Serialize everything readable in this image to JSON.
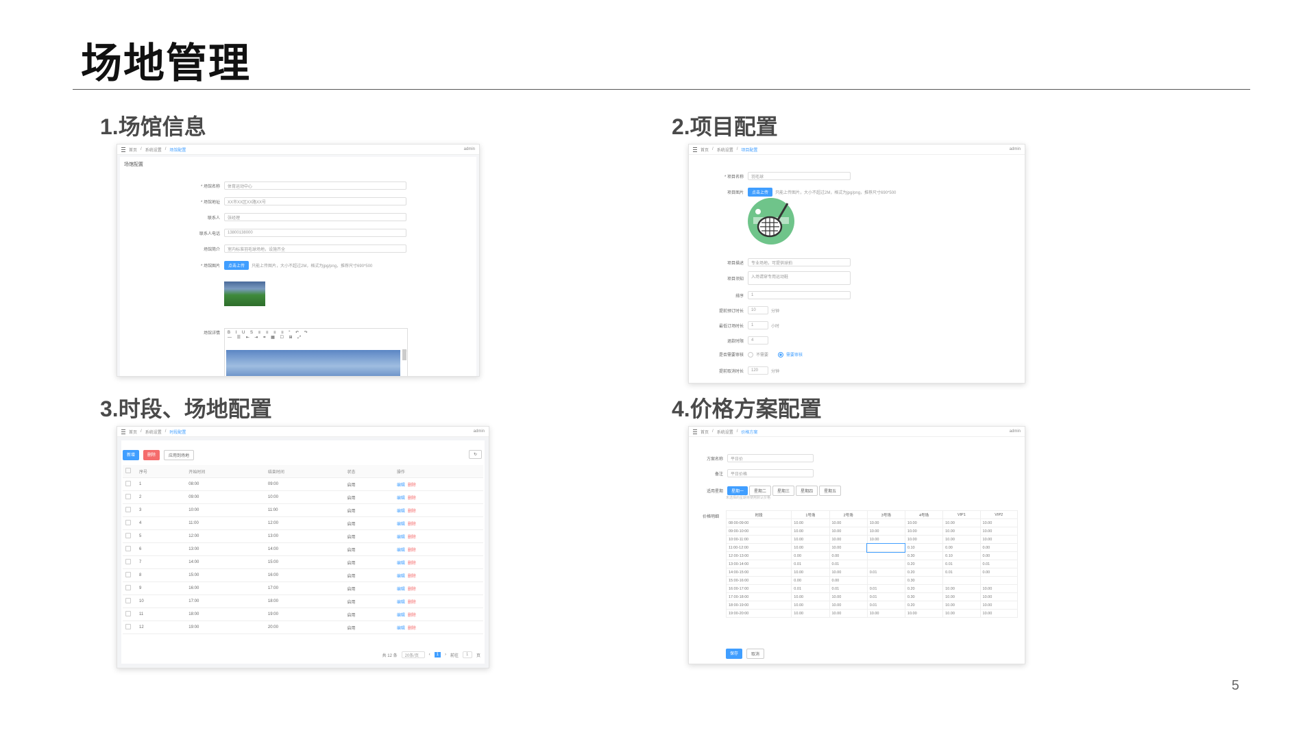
{
  "slide": {
    "title": "场地管理",
    "page_number": "5"
  },
  "sections": {
    "s1": "1.场馆信息",
    "s2": "2.项目配置",
    "s3": "3.时段、场地配置",
    "s4": "4.价格方案配置"
  },
  "shot1": {
    "breadcrumb": [
      "首页",
      "系统设置",
      "场馆配置"
    ],
    "user": "admin",
    "panel_title": "场馆配置",
    "fields": [
      {
        "label": "* 场馆名称",
        "value": "体育运动中心"
      },
      {
        "label": "* 场馆地址",
        "value": "XX市XX区XX路XX号"
      },
      {
        "label": "联系人",
        "value": "张经理"
      },
      {
        "label": "联系人电话",
        "value": "13800138000"
      },
      {
        "label": "场馆简介",
        "value": "室内标准羽毛球场地，设施齐全"
      }
    ],
    "image_label": "* 场馆图片",
    "upload_button": "点击上传",
    "upload_hint": "只能上传图片，大小不超过2M，格式为jpg/png，推荐尺寸690*500",
    "detail_label": "场馆详情",
    "colors": {
      "accent": "#409eff"
    }
  },
  "shot2": {
    "breadcrumb": [
      "首页",
      "系统设置",
      "项目配置"
    ],
    "user": "admin",
    "fields": [
      {
        "label": "* 项目名称",
        "value": "羽毛球"
      },
      {
        "label": "项目图片",
        "value": ""
      },
      {
        "label": "项目描述",
        "value": "专业场地，可提供球拍"
      },
      {
        "label": "项目须知",
        "value": "入场请穿专用运动鞋"
      },
      {
        "label": "排序",
        "value": "1"
      },
      {
        "label": "提前预订时长",
        "value": "10"
      },
      {
        "label": "最低订场时长",
        "value": "1"
      },
      {
        "label": "退款时限",
        "value": "4"
      },
      {
        "label": "是否需要审核",
        "value": ""
      },
      {
        "label": "提前取消时长",
        "value": "120"
      }
    ],
    "upload_button": "点击上传",
    "upload_hint": "只能上传图片，大小不超过2M，格式为jpg/png，推荐尺寸690*500",
    "unit_minutes": "分钟",
    "unit_hours": "小时",
    "radio_options": [
      "不需要",
      "需要审核"
    ],
    "icon": "tennis-racket-icon"
  },
  "shot3": {
    "breadcrumb": [
      "首页",
      "系统设置",
      "时段配置"
    ],
    "user": "admin",
    "buttons": {
      "add": "新增",
      "delete": "删除",
      "apply": "应用到场地"
    },
    "columns": [
      "序号",
      "开始时间",
      "结束时间",
      "状态",
      "操作"
    ],
    "rows": [
      [
        "1",
        "08:00",
        "09:00",
        "启用"
      ],
      [
        "2",
        "09:00",
        "10:00",
        "启用"
      ],
      [
        "3",
        "10:00",
        "11:00",
        "启用"
      ],
      [
        "4",
        "11:00",
        "12:00",
        "启用"
      ],
      [
        "5",
        "12:00",
        "13:00",
        "启用"
      ],
      [
        "6",
        "13:00",
        "14:00",
        "启用"
      ],
      [
        "7",
        "14:00",
        "15:00",
        "启用"
      ],
      [
        "8",
        "15:00",
        "16:00",
        "启用"
      ],
      [
        "9",
        "16:00",
        "17:00",
        "启用"
      ],
      [
        "10",
        "17:00",
        "18:00",
        "启用"
      ],
      [
        "11",
        "18:00",
        "19:00",
        "启用"
      ],
      [
        "12",
        "19:00",
        "20:00",
        "启用"
      ]
    ],
    "action_edit": "编辑",
    "action_delete": "删除",
    "pagination": {
      "total": "共 12 条",
      "page_size": "20条/页",
      "current": "1",
      "goto_label": "前往",
      "goto_value": "1",
      "suffix": "页"
    }
  },
  "shot4": {
    "breadcrumb": [
      "首页",
      "系统设置",
      "价格方案"
    ],
    "user": "admin",
    "fields": [
      {
        "label": "方案名称",
        "value": "平日价"
      },
      {
        "label": "备注",
        "value": "平日价格"
      }
    ],
    "apply_label": "适用星期",
    "weekdays": [
      "星期一",
      "星期二",
      "星期三",
      "星期四",
      "星期五"
    ],
    "weekday_hint": "未选择的星期将使用默认价格",
    "price_label": "价格明细",
    "columns": [
      "时段",
      "1号场",
      "2号场",
      "3号场",
      "4号场",
      "VIP1",
      "VIP2"
    ],
    "rows": [
      [
        "08:00-09:00",
        "10.00",
        "10.00",
        "10.00",
        "10.00",
        "10.00",
        "10.00"
      ],
      [
        "09:00-10:00",
        "10.00",
        "10.00",
        "10.00",
        "10.00",
        "10.00",
        "10.00"
      ],
      [
        "10:00-11:00",
        "10.00",
        "10.00",
        "10.00",
        "10.00",
        "10.00",
        "10.00"
      ],
      [
        "11:00-12:00",
        "10.00",
        "10.00",
        "",
        "0.10",
        "0.00",
        "0.00"
      ],
      [
        "12:00-13:00",
        "0.00",
        "0.00",
        "",
        "0.30",
        "0.10",
        "0.00"
      ],
      [
        "13:00-14:00",
        "0.01",
        "0.01",
        "",
        "0.20",
        "0.01",
        "0.01"
      ],
      [
        "14:00-15:00",
        "10.00",
        "10.00",
        "0.01",
        "0.20",
        "0.01",
        "0.00"
      ],
      [
        "15:00-16:00",
        "0.00",
        "0.00",
        "",
        "0.30",
        "",
        ""
      ],
      [
        "16:00-17:00",
        "0.01",
        "0.01",
        "0.01",
        "0.20",
        "10.00",
        "10.00"
      ],
      [
        "17:00-18:00",
        "10.00",
        "10.00",
        "0.01",
        "0.30",
        "10.00",
        "10.00"
      ],
      [
        "18:00-19:00",
        "10.00",
        "10.00",
        "0.01",
        "0.20",
        "10.00",
        "10.00"
      ],
      [
        "19:00-20:00",
        "10.00",
        "10.00",
        "10.00",
        "10.00",
        "10.00",
        "10.00"
      ]
    ],
    "buttons": {
      "save": "保存",
      "cancel": "取消"
    }
  }
}
